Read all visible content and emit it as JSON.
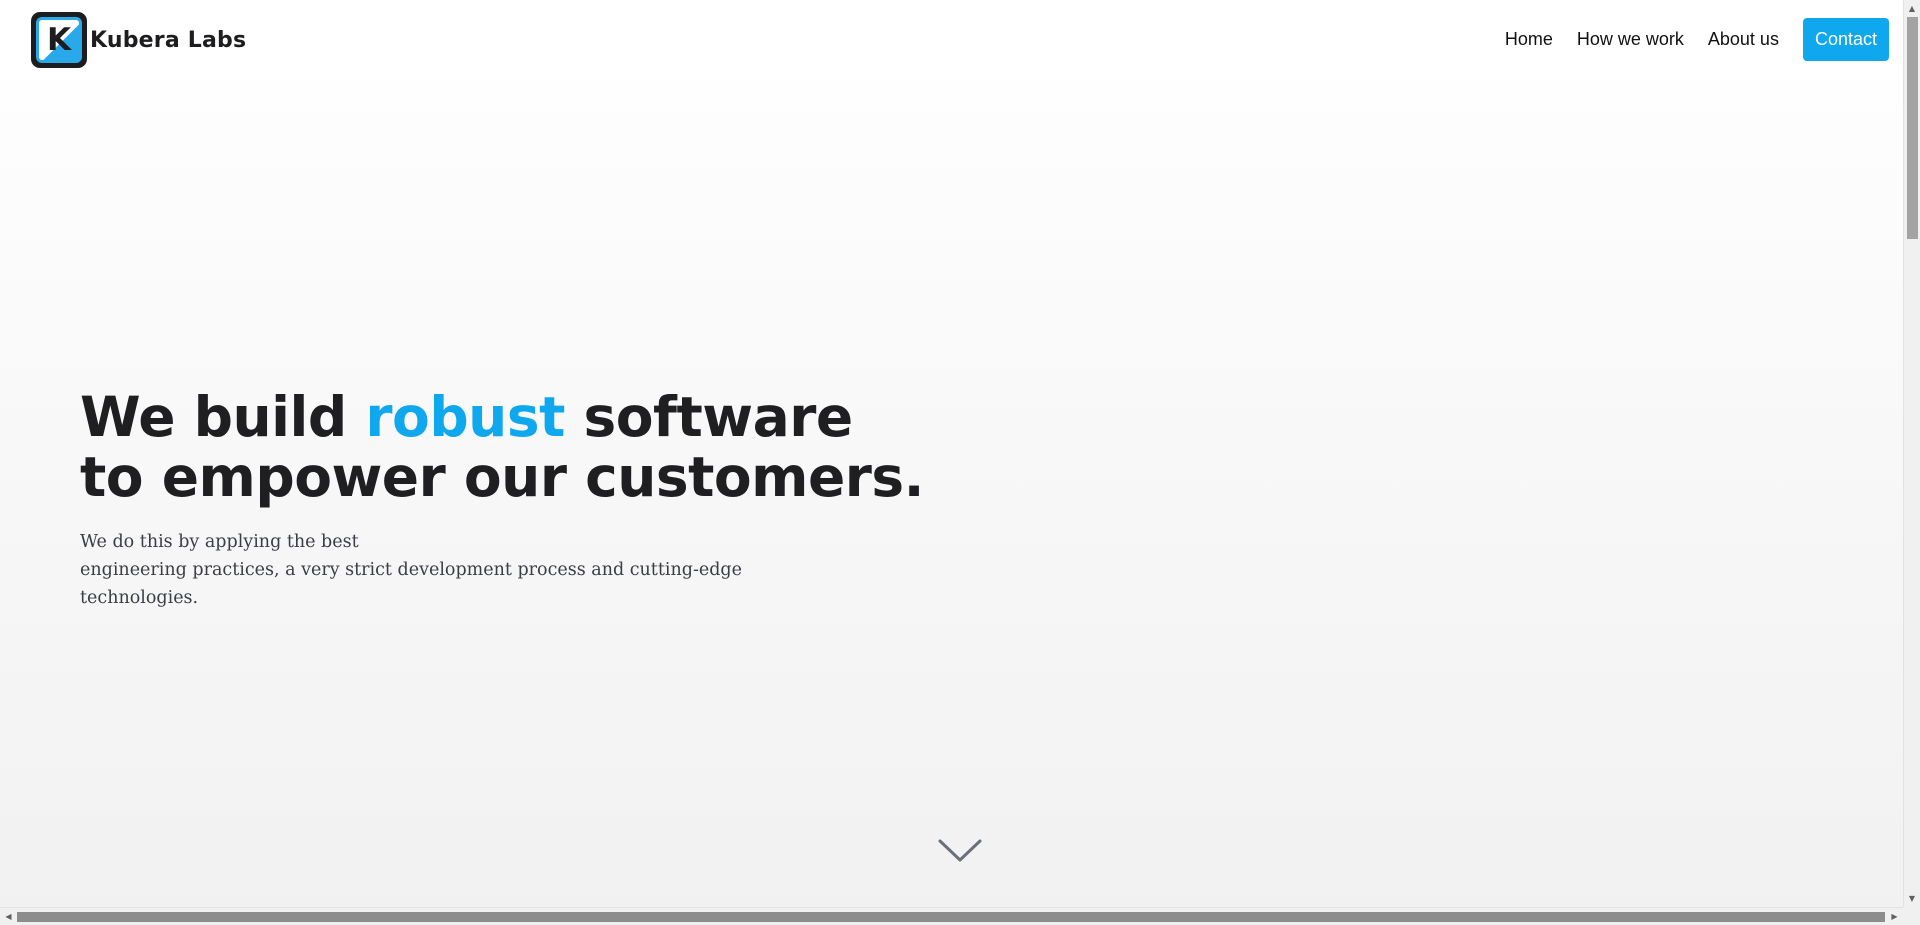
{
  "brand": {
    "logo_letter": "K",
    "name": "Kubera Labs"
  },
  "nav": {
    "items": [
      {
        "label": "Home"
      },
      {
        "label": "How we work"
      },
      {
        "label": "About us"
      }
    ],
    "contact_label": "Contact"
  },
  "hero": {
    "title_part1": "We build ",
    "title_accent": "robust",
    "title_part2": " software",
    "title_line2": "to empower our customers.",
    "subtitle_line1": "We do this by applying the best",
    "subtitle_line2": "engineering practices, a very strict development process and cutting-edge",
    "subtitle_line3": "technologies."
  },
  "colors": {
    "accent": "#0fa8ef",
    "text_dark": "#1f1f21",
    "text_muted": "#3b3d45",
    "background": "#f7f7f7"
  },
  "icons": {
    "scroll_cue": "chevron-down-icon",
    "scroll_up": "triangle-up-icon",
    "scroll_down": "triangle-down-icon",
    "scroll_left": "triangle-left-icon",
    "scroll_right": "triangle-right-icon"
  }
}
